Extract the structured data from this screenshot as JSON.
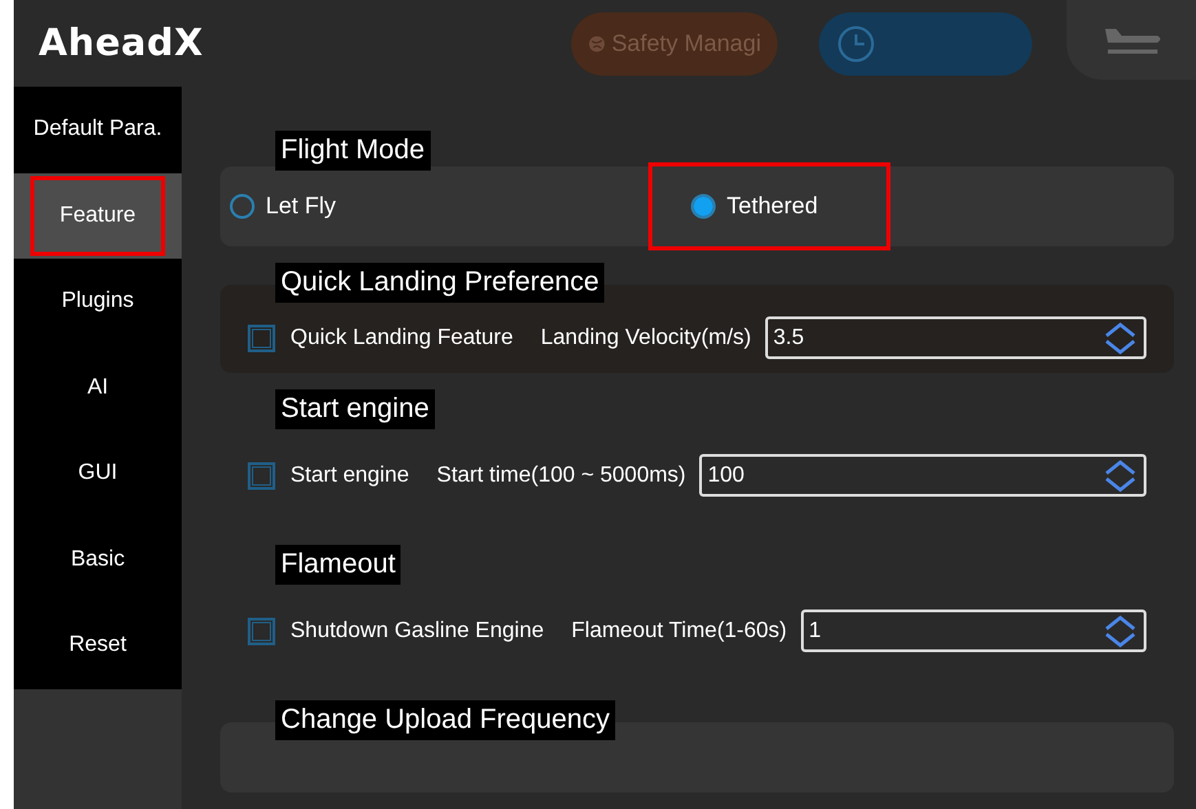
{
  "header": {
    "logo": "AheadX",
    "buttons": [
      {
        "kind": "safety",
        "label": "Safety Managi"
      },
      {
        "kind": "clock"
      },
      {
        "kind": "plane"
      }
    ]
  },
  "sidebar": {
    "items": [
      {
        "label": "Default Para.",
        "selected": false,
        "highlighted": false
      },
      {
        "label": "Feature",
        "selected": true,
        "highlighted": true
      },
      {
        "label": "Plugins",
        "selected": false,
        "highlighted": false
      },
      {
        "label": "AI",
        "selected": false,
        "highlighted": false
      },
      {
        "label": "GUI",
        "selected": false,
        "highlighted": false
      },
      {
        "label": "Basic",
        "selected": false,
        "highlighted": false
      },
      {
        "label": "Reset",
        "selected": false,
        "highlighted": false
      }
    ]
  },
  "sections": [
    {
      "title": "Flight Mode",
      "kind": "radio",
      "panel": true,
      "options": [
        {
          "label": "Let Fly",
          "selected": false,
          "highlighted": false
        },
        {
          "label": "Tethered",
          "selected": true,
          "highlighted": true
        }
      ]
    },
    {
      "title": "Quick Landing Preference",
      "kind": "checkbox",
      "panel": true,
      "checkbox": {
        "label": "Quick Landing Feature",
        "checked": false
      },
      "field": {
        "label": "Landing Velocity(m/s)",
        "value": "3.5"
      }
    },
    {
      "title": "Start engine",
      "kind": "checkbox",
      "panel": false,
      "checkbox": {
        "label": "Start engine",
        "checked": false
      },
      "field": {
        "label": "Start time(100 ~ 5000ms)",
        "value": "100"
      }
    },
    {
      "title": "Flameout",
      "kind": "checkbox",
      "panel": false,
      "checkbox": {
        "label": "Shutdown Gasline Engine",
        "checked": false
      },
      "field": {
        "label": "Flameout Time(1-60s)",
        "value": "1"
      }
    },
    {
      "title": "Change Upload Frequency",
      "kind": "heading",
      "panel": true
    }
  ]
}
